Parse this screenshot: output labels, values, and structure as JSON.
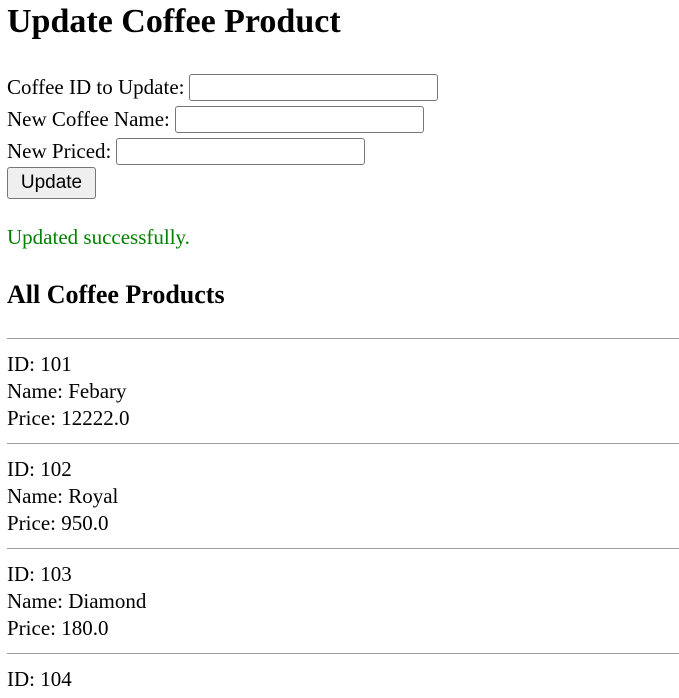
{
  "page": {
    "title": "Update Coffee Product"
  },
  "form": {
    "id_label": "Coffee ID to Update:",
    "id_value": "",
    "name_label": "New Coffee Name:",
    "name_value": "",
    "price_label": "New Priced:",
    "price_value": "",
    "submit_label": "Update"
  },
  "status": {
    "message": "Updated successfully.",
    "color": "#008000"
  },
  "products": {
    "heading": "All Coffee Products",
    "items": [
      {
        "id": "ID: 101",
        "name": "Name: Febary",
        "price": "Price: 12222.0"
      },
      {
        "id": "ID: 102",
        "name": "Name: Royal",
        "price": "Price: 950.0"
      },
      {
        "id": "ID: 103",
        "name": "Name: Diamond",
        "price": "Price: 180.0"
      },
      {
        "id": "ID: 104",
        "name": "",
        "price": ""
      }
    ]
  }
}
